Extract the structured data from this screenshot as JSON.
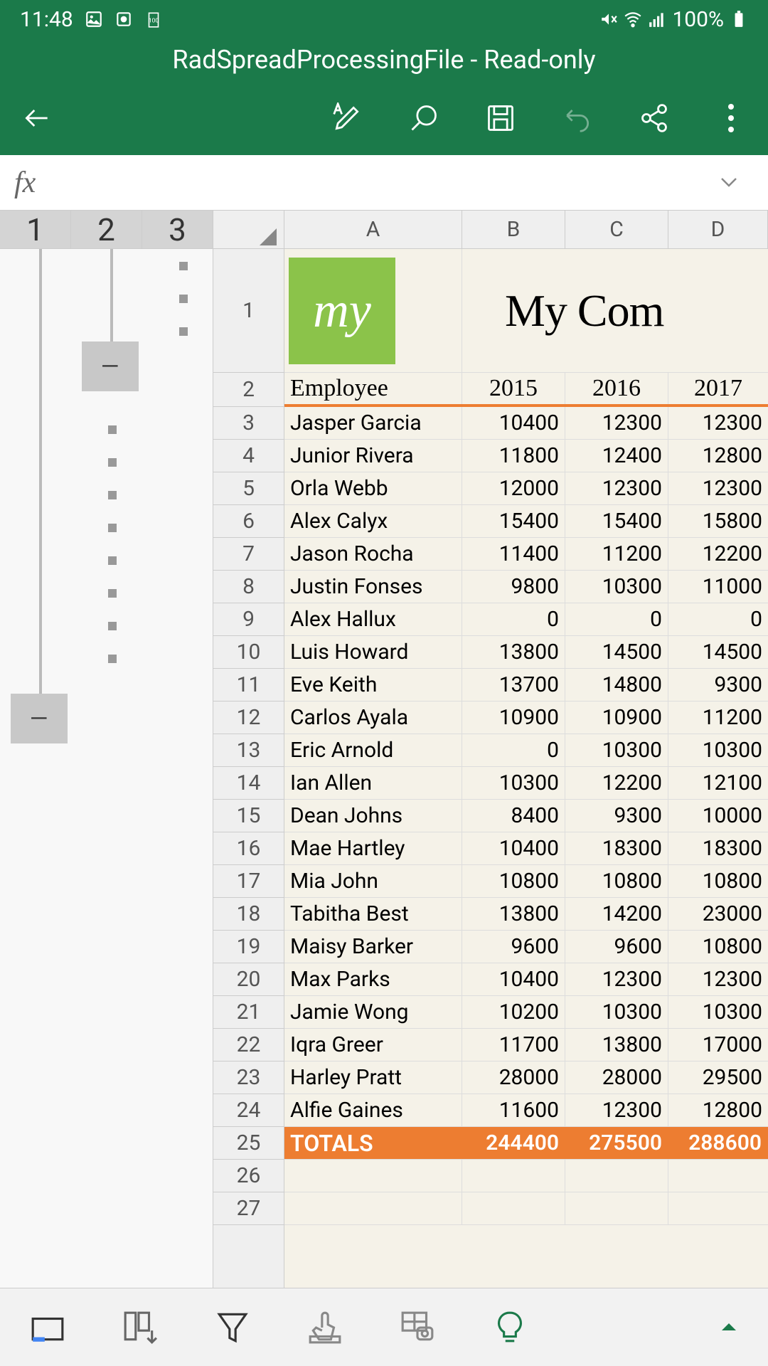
{
  "status": {
    "time": "11:48",
    "battery": "100%"
  },
  "title": "RadSpreadProcessingFile - Read-only",
  "formula": {
    "fx": "fx",
    "value": ""
  },
  "outline_levels": [
    "1",
    "2",
    "3"
  ],
  "columns": [
    "A",
    "B",
    "C",
    "D"
  ],
  "company_title": "My Com",
  "logo_text": "my",
  "headers": {
    "employee": "Employee",
    "y2015": "2015",
    "y2016": "2016",
    "y2017": "2017"
  },
  "rows": [
    {
      "n": "3",
      "name": "Jasper Garcia",
      "b": "10400",
      "c": "12300",
      "d": "12300"
    },
    {
      "n": "4",
      "name": "Junior Rivera",
      "b": "11800",
      "c": "12400",
      "d": "12800"
    },
    {
      "n": "5",
      "name": "Orla Webb",
      "b": "12000",
      "c": "12300",
      "d": "12300"
    },
    {
      "n": "6",
      "name": "Alex Calyx",
      "b": "15400",
      "c": "15400",
      "d": "15800"
    },
    {
      "n": "7",
      "name": "Jason Rocha",
      "b": "11400",
      "c": "11200",
      "d": "12200"
    },
    {
      "n": "8",
      "name": "Justin Fonses",
      "b": "9800",
      "c": "10300",
      "d": "11000"
    },
    {
      "n": "9",
      "name": "Alex Hallux",
      "b": "0",
      "c": "0",
      "d": "0"
    },
    {
      "n": "10",
      "name": "Luis Howard",
      "b": "13800",
      "c": "14500",
      "d": "14500"
    },
    {
      "n": "11",
      "name": "Eve Keith",
      "b": "13700",
      "c": "14800",
      "d": "9300"
    },
    {
      "n": "12",
      "name": "Carlos Ayala",
      "b": "10900",
      "c": "10900",
      "d": "11200"
    },
    {
      "n": "13",
      "name": "Eric Arnold",
      "b": "0",
      "c": "10300",
      "d": "10300"
    },
    {
      "n": "14",
      "name": "Ian Allen",
      "b": "10300",
      "c": "12200",
      "d": "12100"
    },
    {
      "n": "15",
      "name": "Dean Johns",
      "b": "8400",
      "c": "9300",
      "d": "10000"
    },
    {
      "n": "16",
      "name": "Mae Hartley",
      "b": "10400",
      "c": "18300",
      "d": "18300"
    },
    {
      "n": "17",
      "name": "Mia John",
      "b": "10800",
      "c": "10800",
      "d": "10800"
    },
    {
      "n": "18",
      "name": "Tabitha Best",
      "b": "13800",
      "c": "14200",
      "d": "23000"
    },
    {
      "n": "19",
      "name": "Maisy Barker",
      "b": "9600",
      "c": "9600",
      "d": "10800"
    },
    {
      "n": "20",
      "name": "Max Parks",
      "b": "10400",
      "c": "12300",
      "d": "12300"
    },
    {
      "n": "21",
      "name": "Jamie Wong",
      "b": "10200",
      "c": "10300",
      "d": "10300"
    },
    {
      "n": "22",
      "name": "Iqra Greer",
      "b": "11700",
      "c": "13800",
      "d": "17000"
    },
    {
      "n": "23",
      "name": "Harley Pratt",
      "b": "28000",
      "c": "28000",
      "d": "29500"
    },
    {
      "n": "24",
      "name": "Alfie Gaines",
      "b": "11600",
      "c": "12300",
      "d": "12800"
    }
  ],
  "totals": {
    "n": "25",
    "label": "TOTALS",
    "b": "244400",
    "c": "275500",
    "d": "288600"
  },
  "empty_rows": [
    "26",
    "27"
  ]
}
